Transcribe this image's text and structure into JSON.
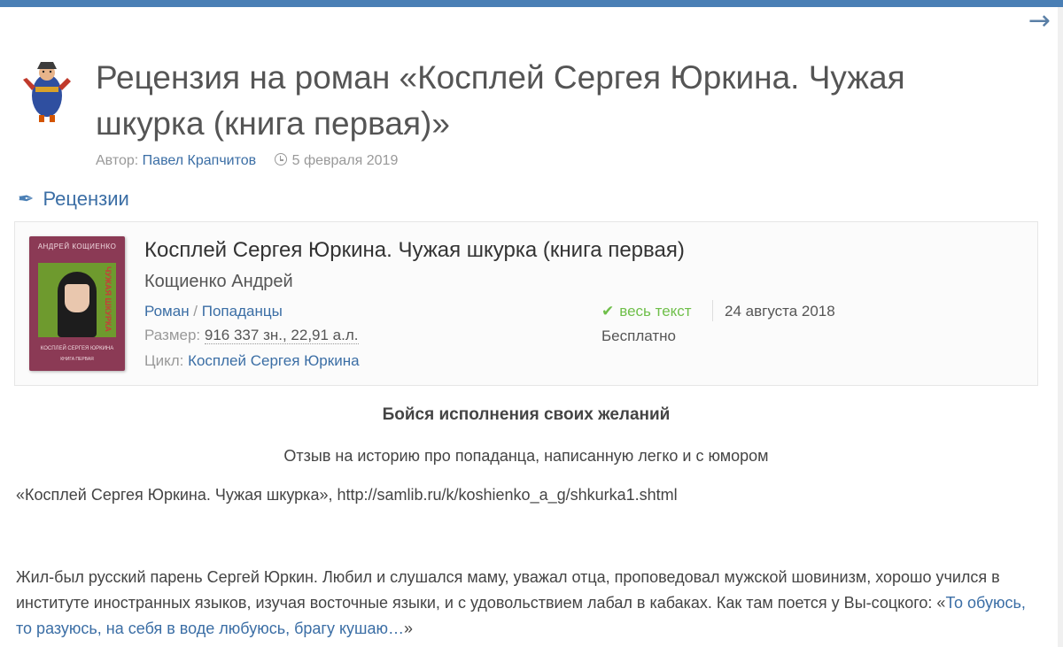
{
  "nav": {
    "next_arrow": "→"
  },
  "article": {
    "title": "Рецензия на роман «Косплей Сергея Юркина. Чужая шкурка (книга первая)»",
    "author_label": "Автор:",
    "author_name": "Павел Крапчитов",
    "date": "5 февраля 2019",
    "category": "Рецензии"
  },
  "book": {
    "cover_author": "АНДРЕЙ КОЩИЕНКО",
    "cover_title": "ЧУЖАЯ ШКУРКА",
    "cover_series": "КОСПЛЕЙ СЕРГЕЯ ЮРКИНА",
    "cover_sub": "КНИГА ПЕРВАЯ",
    "title": "Косплей Сергея Юркина. Чужая шкурка (книга первая)",
    "author": "Кощиенко Андрей",
    "genre": "Роман",
    "genre_sep": " / ",
    "subgenre": "Попаданцы",
    "size_label": "Размер: ",
    "size_value": "916 337 зн., 22,91 а.л.",
    "cycle_label": "Цикл: ",
    "cycle": "Косплей Сергея Юркина",
    "fulltext": "весь текст",
    "date": "24 августа 2018",
    "price": "Бесплатно"
  },
  "body": {
    "heading": "Бойся исполнения своих желаний",
    "subheading": "Отзыв на историю про попаданца, написанную легко и с юмором",
    "reference": "«Косплей Сергея Юркина. Чужая шкурка», http://samlib.ru/k/koshienko_a_g/shkurka1.shtml",
    "paragraph_text": "Жил-был русский парень Сергей Юркин. Любил и слушался маму, уважал отца, проповедовал мужской шовинизм, хорошо учился в институте иностранных языков, изучая восточные языки, и с удовольствием лабал в кабаках. Как там поется у Вы-соцкого: «",
    "paragraph_link": "То обуюсь, то разуюсь, на себя в воде любуюсь, брагу кушаю…",
    "paragraph_end": "»"
  },
  "colors": {
    "accent": "#3b6ea5",
    "topbar": "#4a7fb5",
    "ok": "#6fbf4a"
  }
}
